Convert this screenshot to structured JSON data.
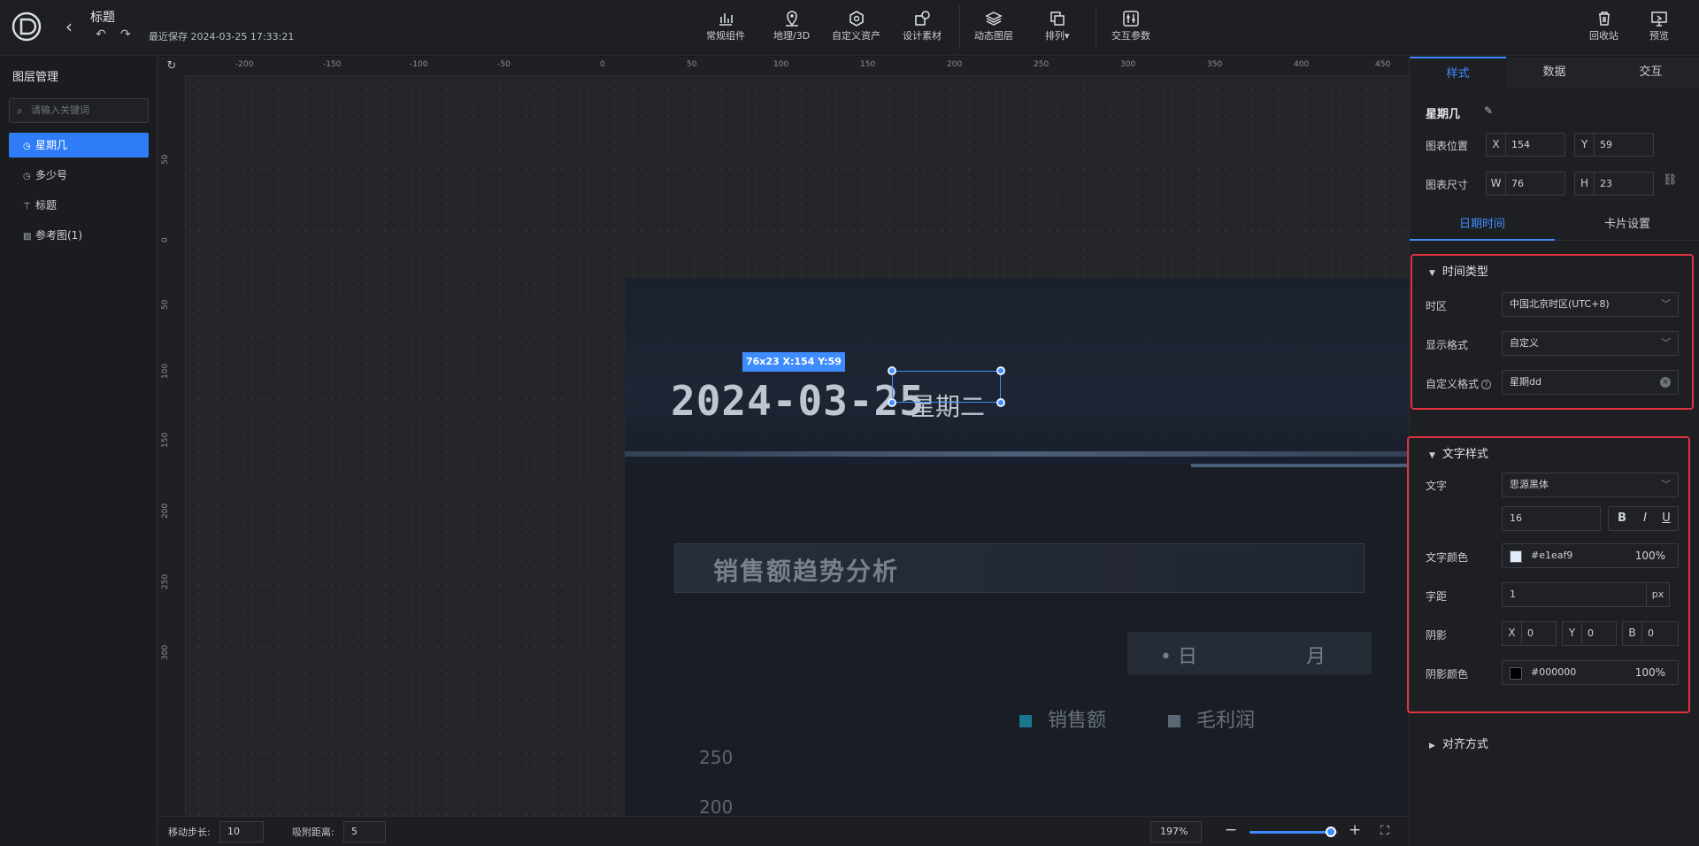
{
  "header": {
    "doc_title": "标题",
    "saved_label": "最近保存 2024-03-25 17:33:21",
    "tools": [
      {
        "label": "常规组件",
        "icon": "bar-chart-icon"
      },
      {
        "label": "地理/3D",
        "icon": "map-pin-icon"
      },
      {
        "label": "自定义资产",
        "icon": "hexagon-icon"
      },
      {
        "label": "设计素材",
        "icon": "shapes-icon"
      },
      {
        "label": "动态图层",
        "icon": "layers-icon"
      },
      {
        "label": "排列▾",
        "icon": "arrange-icon"
      },
      {
        "label": "交互参数",
        "icon": "sliders-icon"
      }
    ],
    "recycle_label": "回收站",
    "preview_label": "预览"
  },
  "layers": {
    "title": "图层管理",
    "search_placeholder": "请输入关键词",
    "items": [
      {
        "label": "星期几",
        "icon": "clock-icon",
        "selected": true
      },
      {
        "label": "多少号",
        "icon": "clock-icon",
        "selected": false
      },
      {
        "label": "标题",
        "icon": "text-icon",
        "selected": false
      },
      {
        "label": "参考图(1)",
        "icon": "image-icon",
        "selected": false
      }
    ]
  },
  "ruler": {
    "h_ticks": [
      "-200",
      "-150",
      "-100",
      "-50",
      "0",
      "50",
      "100",
      "150",
      "200",
      "250",
      "300",
      "350",
      "400",
      "450"
    ],
    "v_ticks": [
      "50",
      "0",
      "50",
      "100",
      "150",
      "200",
      "250",
      "300"
    ]
  },
  "artboard": {
    "date_text": "2024-03-25",
    "week_text": "星期二",
    "panel_title": "销售额趋势分析",
    "tab_day": "• 日",
    "tab_month": "月",
    "legend": [
      {
        "label": "销售额",
        "color": "#1d8aa8"
      },
      {
        "label": "毛利润",
        "color": "#6b7a88"
      }
    ],
    "y_labels": [
      "250",
      "200"
    ],
    "selection_tag": "76x23   X:154 Y:59"
  },
  "bottom": {
    "step_label": "移动步长:",
    "step_value": "10",
    "snap_label": "吸附距离:",
    "snap_value": "5",
    "zoom_value": "197%",
    "zoom_level": 0.92
  },
  "props": {
    "tabs": [
      "样式",
      "数据",
      "交互"
    ],
    "component_name": "星期几",
    "position_label": "图表位置",
    "x_key": "X",
    "x_value": "154",
    "y_key": "Y",
    "y_value": "59",
    "size_label": "图表尺寸",
    "w_key": "W",
    "w_value": "76",
    "h_key": "H",
    "h_value": "23",
    "subtabs": [
      "日期时间",
      "卡片设置"
    ],
    "time_group": {
      "title": "时间类型",
      "timezone_label": "时区",
      "timezone_value": "中国北京时区(UTC+8)",
      "format_label": "显示格式",
      "format_value": "自定义",
      "custom_label": "自定义格式",
      "custom_value": "星期dd"
    },
    "text_group": {
      "title": "文字样式",
      "font_label": "文字",
      "font_value": "思源黑体",
      "size_value": "16",
      "bold": "B",
      "italic": "I",
      "underline": "U",
      "color_label": "文字颜色",
      "color_value": "#e1eaf9",
      "color_opacity": "100%",
      "spacing_label": "字距",
      "spacing_value": "1",
      "spacing_unit": "px",
      "shadow_label": "阴影",
      "shadow_x_key": "X",
      "shadow_x": "0",
      "shadow_y_key": "Y",
      "shadow_y": "0",
      "shadow_b_key": "B",
      "shadow_b": "0",
      "shadow_color_label": "阴影颜色",
      "shadow_color_value": "#000000",
      "shadow_opacity": "100%"
    },
    "align_title": "对齐方式"
  },
  "colors": {
    "accent": "#3f8cff",
    "highlight_border": "#e0323e",
    "text_color_swatch": "#e1eaf9",
    "shadow_color_swatch": "#000000"
  }
}
